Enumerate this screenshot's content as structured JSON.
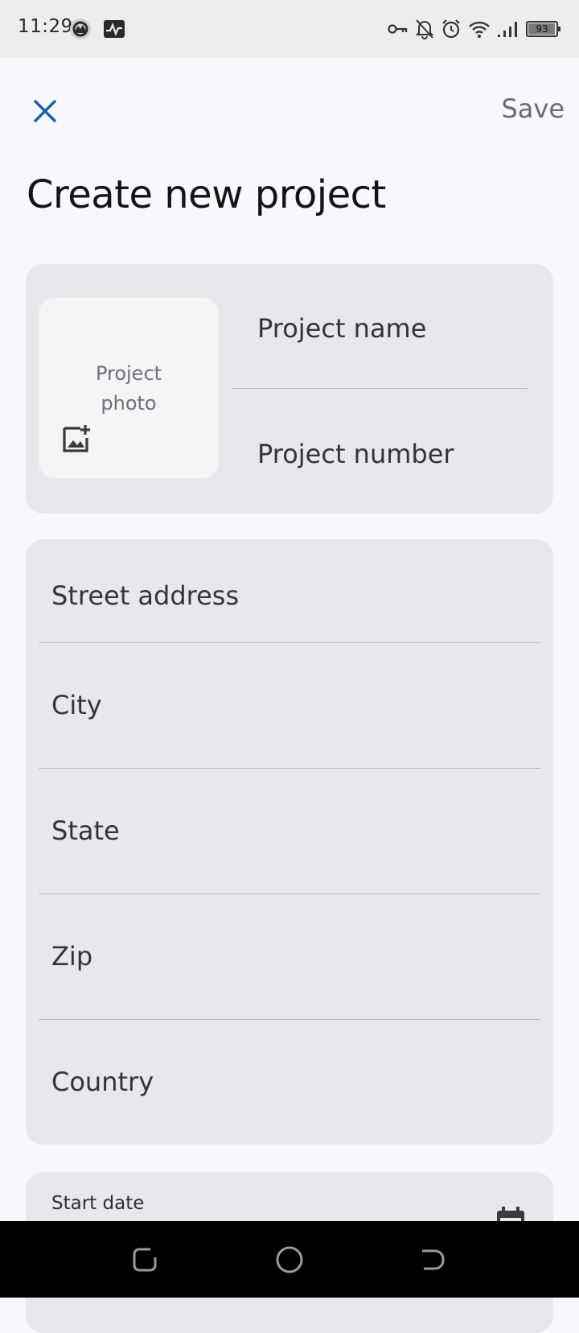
{
  "status_bar": {
    "time": "11:29",
    "battery": "93",
    "icons": [
      "app-icon",
      "pulse-icon",
      "vpn-key-icon",
      "bell-off-icon",
      "alarm-icon",
      "wifi-icon",
      "signal-icon",
      "battery-icon"
    ]
  },
  "header": {
    "close_icon": "close-icon",
    "save_label": "Save",
    "title": "Create new project"
  },
  "project_card": {
    "photo_label": "Project\nphoto",
    "photo_icon": "add-photo-icon",
    "name_placeholder": "Project name",
    "name_value": "",
    "number_placeholder": "Project number",
    "number_value": ""
  },
  "address_card": {
    "street_placeholder": "Street address",
    "city_placeholder": "City",
    "state_placeholder": "State",
    "zip_placeholder": "Zip",
    "country_placeholder": "Country"
  },
  "date_card": {
    "start_label": "Start date",
    "calendar_icon": "calendar-icon"
  },
  "nav_bar": {
    "icons": [
      "recents-icon",
      "home-icon",
      "back-icon"
    ]
  },
  "colors": {
    "accent": "#1d5fa0",
    "background": "#f8f8fc",
    "card": "#e8e8ec",
    "photo_box": "#f5f5f8"
  }
}
